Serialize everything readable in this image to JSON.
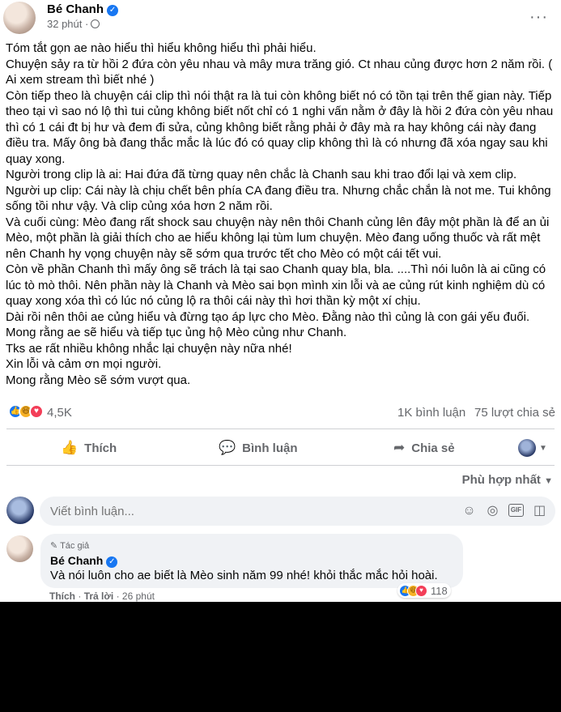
{
  "post": {
    "author": "Bé Chanh",
    "time": "32 phút ·",
    "more": "···",
    "paragraphs": [
      "Tóm tắt gọn ae nào hiểu thì hiểu không hiểu thì phải hiểu.",
      "Chuyện sảy ra từ hồi 2 đứa còn yêu nhau và mây mưa trăng gió. Ct nhau củng được hơn 2 năm rồi. ( Ai xem stream thì biết nhé )",
      "Còn tiếp theo là chuyện cái clip thì nói thật ra là tui còn không biết nó có tồn tại trên thế gian này. Tiếp theo tại vì sao nó lộ thì tui củng không biết nốt chỉ có 1 nghi vấn nằm ở đây là hồi 2 đứa còn yêu nhau thì có 1 cái đt bị hư và đem đi sửa, củng không biết rằng phải ở đây mà ra hay không cái này đang điều tra. Mấy ông bà đang thắc mắc là lúc đó có quay clip không thì là có nhưng đã xóa ngay sau khi quay xong.",
      "Người trong clip là ai: Hai đứa đã từng quay nên chắc là Chanh sau khi trao đổi lại và xem clip.",
      "Người up clip: Cái này là chịu chết bên phía CA đang điều tra. Nhưng chắc chắn là not me. Tui không sống tồi như vậy. Và clip củng xóa hơn 2 năm rồi.",
      "Và cuối cùng: Mèo đang rất shock sau chuyện này nên thôi Chanh củng lên đây một phần là để an ủi Mèo, một phần là giải thích cho ae hiểu không lại tùm lum chuyện. Mèo đang uống thuốc và rất mệt nên Chanh hy vọng chuyện này sẽ sớm qua trước tết cho Mèo có một cái tết vui.",
      "Còn về phần Chanh thì mấy ông sẽ trách là tại sao Chanh quay bla, bla. ....Thì nói luôn là ai cũng có lúc tò mò thôi. Nên phần này là Chanh và Mèo sai bọn mình xin lỗi và ae củng rút kinh nghiệm dù có quay xong xóa thì có lúc nó củng lộ ra thôi cái này thì hơi thần kỳ một xí chịu.",
      "Dài rồi nên thôi ae củng hiểu và đừng tạo áp lực cho Mèo. Đằng nào thì củng là con gái yếu đuối.",
      "Mong rằng ae sẽ hiểu và tiếp tục ủng hộ Mèo củng như Chanh.",
      "Tks ae rất nhiều không nhắc lại chuyện này nữa nhé!",
      "Xin lỗi và cảm ơn mọi người.",
      "Mong rằng Mèo sẽ sớm vượt qua."
    ]
  },
  "stats": {
    "reactions_count": "4,5K",
    "comments": "1K bình luận",
    "shares": "75 lượt chia sẻ"
  },
  "actions": {
    "like": "Thích",
    "comment": "Bình luận",
    "share": "Chia sẻ"
  },
  "sort_label": "Phù hợp nhất",
  "composer": {
    "placeholder": "Viết bình luận..."
  },
  "comment": {
    "badge": "Tác giả",
    "author": "Bé Chanh",
    "text": "Và nói luôn cho ae biết là Mèo sinh năm 99 nhé! khỏi thắc mắc hỏi hoài.",
    "like": "Thích",
    "reply": "Trả lời",
    "time": "26 phút",
    "reaction_count": "118"
  },
  "icons": {
    "like": "like-icon",
    "haha": "haha-icon",
    "love": "love-icon",
    "comment": "comment-icon",
    "share": "share-icon",
    "emoji": "emoji-icon",
    "camera": "camera-icon",
    "gif": "gif-icon",
    "sticker": "sticker-icon"
  },
  "colors": {
    "facebook_blue": "#1877f2",
    "secondary_text": "#65676b",
    "bubble_bg": "#f0f2f5"
  }
}
